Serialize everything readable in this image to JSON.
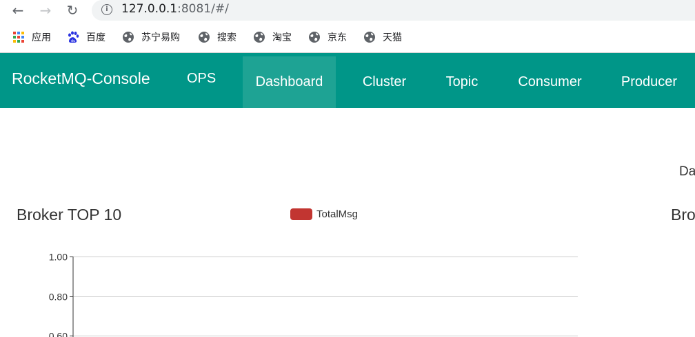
{
  "browser": {
    "url_host": "127.0.0.1",
    "url_rest": ":8081/#/",
    "back_icon": "arrow-left-icon",
    "forward_icon": "arrow-right-icon",
    "reload_icon": "reload-icon",
    "info_icon": "info-icon",
    "bookmarks": [
      {
        "label": "应用",
        "icon": "apps-grid-icon"
      },
      {
        "label": "百度",
        "icon": "baidu-paw-icon"
      },
      {
        "label": "苏宁易购",
        "icon": "globe-icon"
      },
      {
        "label": "搜索",
        "icon": "globe-icon"
      },
      {
        "label": "淘宝",
        "icon": "globe-icon"
      },
      {
        "label": "京东",
        "icon": "globe-icon"
      },
      {
        "label": "天猫",
        "icon": "globe-icon"
      }
    ]
  },
  "navbar": {
    "brand": "RocketMQ-Console",
    "ops": "OPS",
    "items": [
      {
        "label": "Dashboard",
        "active": true
      },
      {
        "label": "Cluster",
        "active": false
      },
      {
        "label": "Topic",
        "active": false
      },
      {
        "label": "Consumer",
        "active": false
      },
      {
        "label": "Producer",
        "active": false
      }
    ],
    "color": "#009688",
    "active_color": "#1ea394"
  },
  "content": {
    "date_label": "Da",
    "left_panel_title": "Broker TOP 10",
    "right_panel_title": "Bro"
  },
  "chart_data": {
    "type": "bar",
    "series": [
      {
        "name": "TotalMsg",
        "values": [],
        "color": "#c23531"
      }
    ],
    "categories": [],
    "yticks": [
      "1.00",
      "0.80",
      "0.60"
    ],
    "ylim": [
      0,
      1
    ],
    "grid": true,
    "legend_position": "top"
  }
}
